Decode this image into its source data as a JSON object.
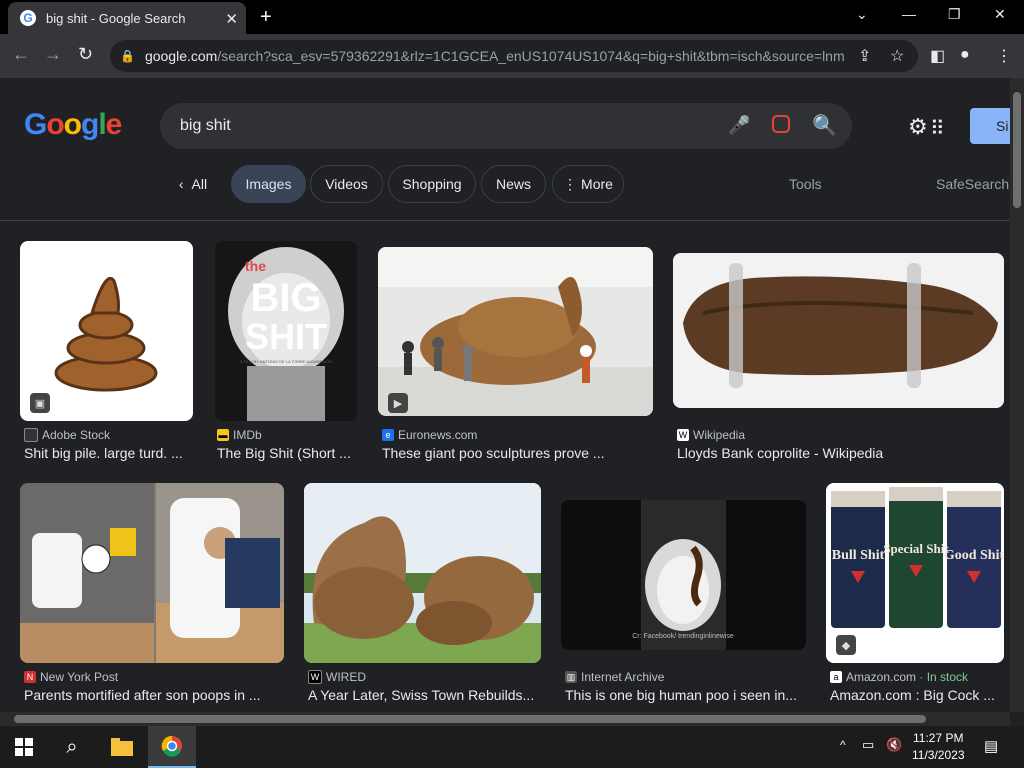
{
  "browser": {
    "tab_title": "big shit - Google Search",
    "url_host": "google.com",
    "url_rest": "/search?sca_esv=579362291&rlz=1C1GCEA_enUS1074US1074&q=big+shit&tbm=isch&source=lnm..."
  },
  "header": {
    "logo": "Google",
    "query": "big shit",
    "signin": "Si"
  },
  "chips": [
    "All",
    "Images",
    "Videos",
    "Shopping",
    "News",
    "More"
  ],
  "tools_label": "Tools",
  "safesearch_label": "SafeSearch",
  "results": [
    {
      "source": "Adobe Stock",
      "caption": "Shit big pile. large turd. ..."
    },
    {
      "source": "IMDb",
      "caption": "The Big Shit (Short ..."
    },
    {
      "source": "Euronews.com",
      "caption": "These giant poo sculptures prove ..."
    },
    {
      "source": "Wikipedia",
      "caption": "Lloyds Bank coprolite - Wikipedia"
    },
    {
      "source": "New York Post",
      "caption": "Parents mortified after son poops in ..."
    },
    {
      "source": "WIRED",
      "caption": "A Year Later, Swiss Town Rebuilds..."
    },
    {
      "source": "Internet Archive",
      "caption": "This is one big human poo i seen in..."
    },
    {
      "source": "Amazon.com",
      "caption": "Amazon.com : Big Cock ...",
      "stock": "· In stock"
    }
  ],
  "thumb_text": {
    "imdb_the": "the",
    "imdb_big": "BIG",
    "imdb_shit": "SHIT",
    "imdb_director": "A FILM BY ANTONIO DE LA TORRE ALBARRACÍN",
    "archive_watermark": "Cr: Facebook/ trendinginlinewise",
    "amazon_labels": [
      "Bull Shit",
      "Special Shit",
      "Good Shit"
    ]
  },
  "clock": {
    "time": "11:27 PM",
    "date": "11/3/2023"
  }
}
